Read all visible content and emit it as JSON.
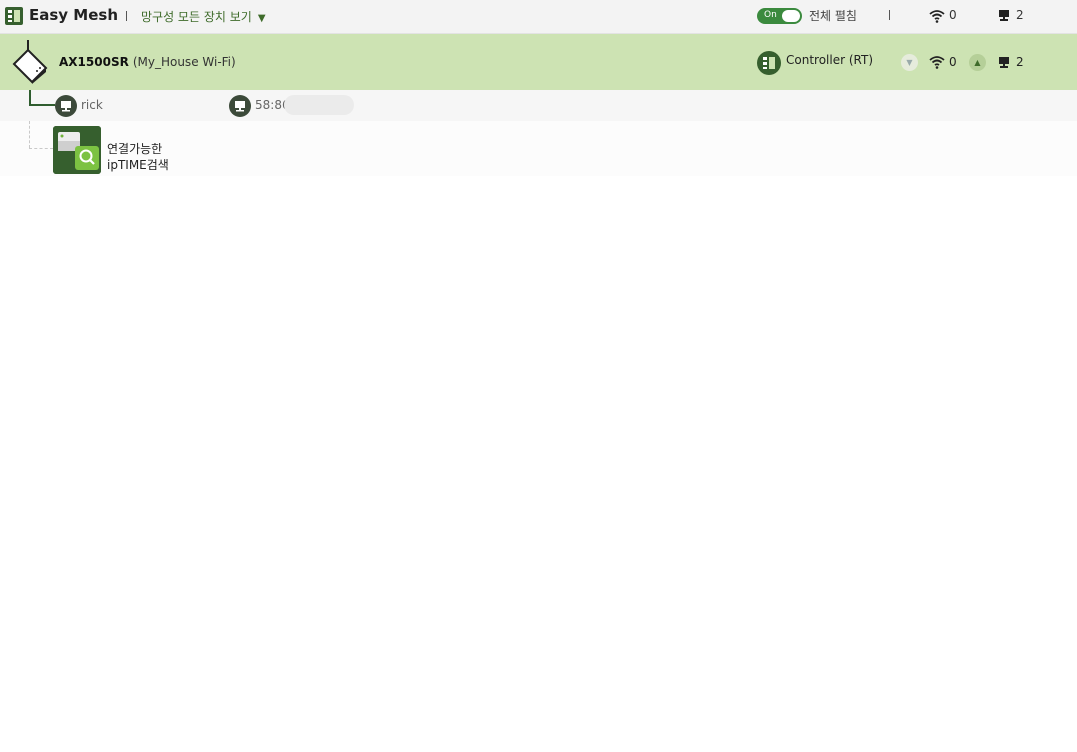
{
  "header": {
    "app_title": "Easy Mesh",
    "view_dropdown_label": "망구성 모든 장치 보기",
    "toggle_label": "On",
    "expand_all_label": "전체 펼침",
    "wifi_count": "0",
    "lan_count": "2"
  },
  "router": {
    "model": "AX1500SR",
    "ssid": "(My_House Wi-Fi)",
    "role": "Controller (RT)",
    "wifi_count": "0",
    "lan_count": "2"
  },
  "client": {
    "name": "rick",
    "mac_prefix": "58:86"
  },
  "search": {
    "label_line1": "연결가능한",
    "label_line2": "ipTIME검색"
  },
  "colors": {
    "accent": "#3b8a3e",
    "router_row_bg": "#cde3b3",
    "dark_green": "#365f2e"
  },
  "icons": [
    "easymesh-logo-icon",
    "wifi-icon",
    "lan-icon",
    "router-icon",
    "controller-icon",
    "pc-icon",
    "search-icon"
  ]
}
